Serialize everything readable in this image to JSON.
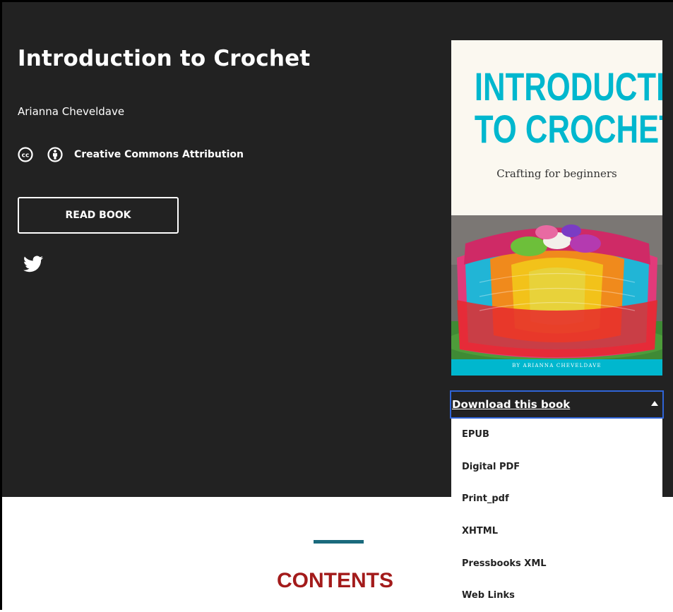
{
  "book": {
    "title": "Introduction to Crochet",
    "author": "Arianna Cheveldave",
    "license": "Creative Commons Attribution",
    "read_button": "READ BOOK"
  },
  "icons": {
    "cc": "cc-icon",
    "attribution": "attribution-icon",
    "share": "twitter-icon",
    "caret": "caret-up-icon"
  },
  "cover": {
    "title_line1": "INTRODUCTION",
    "title_line2": "TO CROCHET",
    "subtitle": "Crafting for beginners",
    "byline": "BY ARIANNA CHEVELDAVE",
    "accent_color": "#00b7ce"
  },
  "download": {
    "label": "Download this book",
    "options": [
      "EPUB",
      "Digital PDF",
      "Print_pdf",
      "XHTML",
      "Pressbooks XML",
      "Web Links"
    ]
  },
  "contents": {
    "heading": "CONTENTS",
    "heading_color": "#a31b1b",
    "bar_color": "#1a6a7d"
  },
  "colors": {
    "hero_background": "#222222",
    "focus_outline": "#2f64d6"
  }
}
